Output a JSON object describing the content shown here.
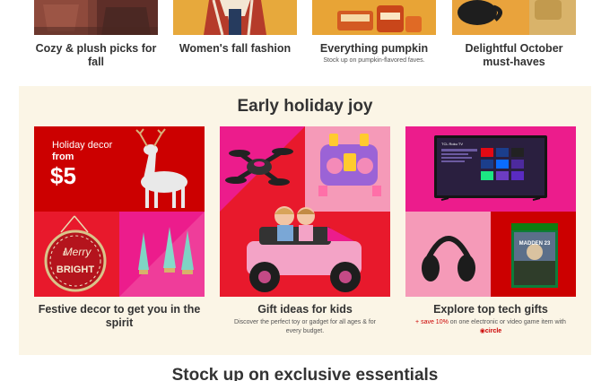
{
  "categories": [
    {
      "title": "Cozy & plush picks for fall",
      "subtitle": "",
      "image_icon": "bedding-icon"
    },
    {
      "title": "Women's fall fashion",
      "subtitle": "",
      "image_icon": "sweater-icon"
    },
    {
      "title": "Everything pumpkin",
      "subtitle": "Stock up on pumpkin-flavored faves.",
      "image_icon": "pumpkin-products-icon"
    },
    {
      "title": "Delightful October must-haves",
      "subtitle": "",
      "image_icon": "mug-icon"
    }
  ],
  "holiday": {
    "title": "Early holiday joy",
    "cards": [
      {
        "title": "Festive decor to get you in the spirit",
        "image_text_line1": "Holiday decor",
        "image_text_line2": "from",
        "image_price": "$5",
        "sign_text_1": "Merry",
        "sign_text_2": "&",
        "sign_text_3": "BRIGHT"
      },
      {
        "title": "Gift ideas for kids",
        "description": "Discover the perfect toy or gadget for all ages & for every budget."
      },
      {
        "title": "Explore top tech gifts",
        "promo": "+ save 10%",
        "promo_rest": " on one electronic or video game item with",
        "circle_logo": "◉circle",
        "tv_brand": "TCL Roku TV",
        "game_title": "MADDEN 23"
      }
    ]
  },
  "bottom_heading": "Stock up on exclusive essentials",
  "colors": {
    "target_red": "#cc0000",
    "section_bg": "#fbf5e6",
    "pink": "#ec1c8c"
  }
}
